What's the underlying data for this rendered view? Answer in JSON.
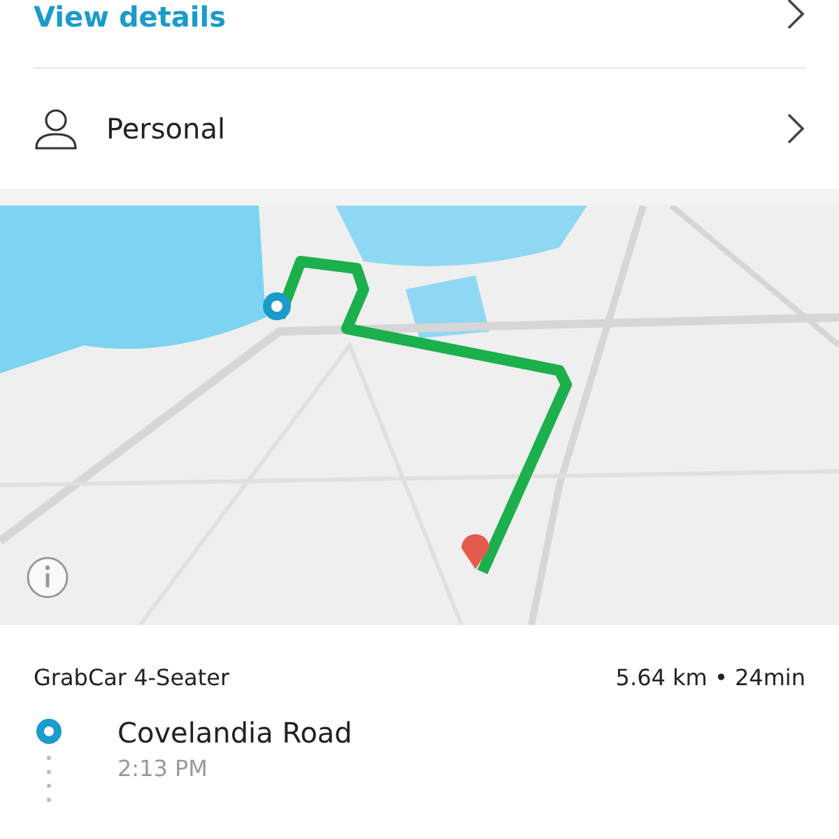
{
  "details_link": {
    "label": "View details"
  },
  "profile": {
    "label": "Personal"
  },
  "ride": {
    "vehicle": "GrabCar 4-Seater",
    "summary": "5.64 km • 24min"
  },
  "stops": [
    {
      "name": "Covelandia Road",
      "time": "2:13 PM"
    }
  ]
}
